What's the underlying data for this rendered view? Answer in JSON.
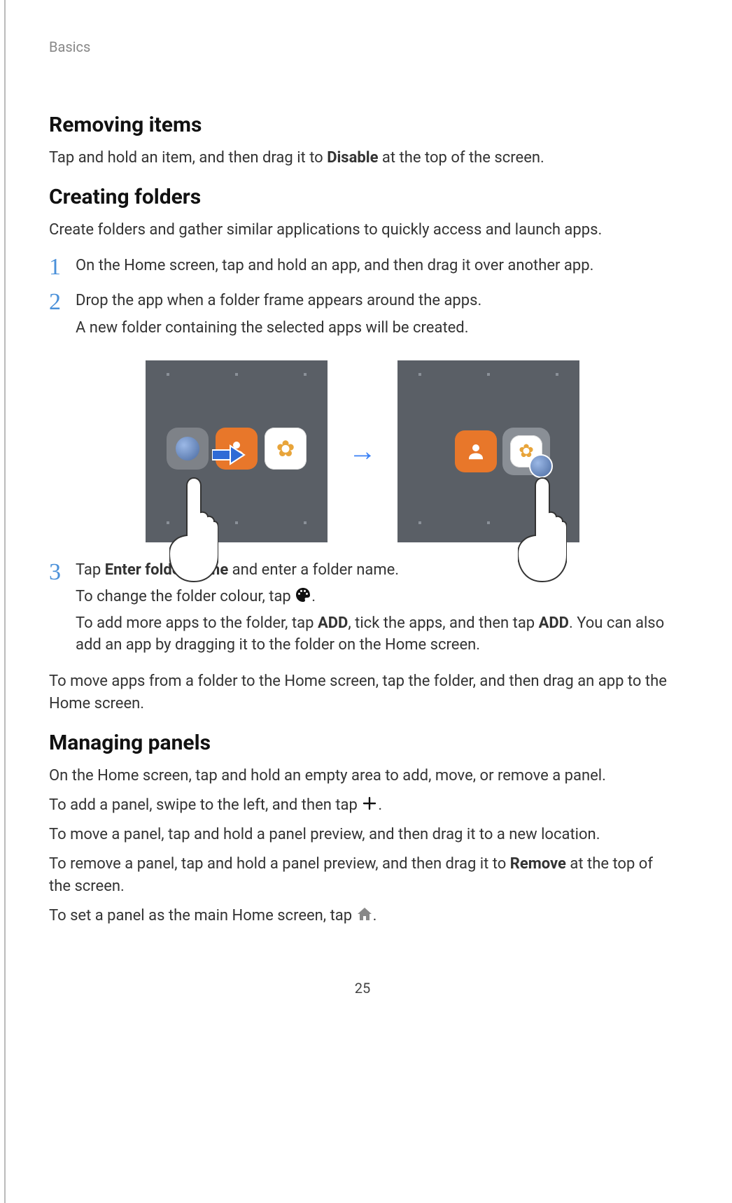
{
  "header": {
    "section": "Basics"
  },
  "removing": {
    "heading": "Removing items",
    "text_pre": "Tap and hold an item, and then drag it to ",
    "text_bold": "Disable",
    "text_post": " at the top of the screen."
  },
  "creating": {
    "heading": "Creating folders",
    "intro": "Create folders and gather similar applications to quickly access and launch apps.",
    "step1_num": "1",
    "step1_text": "On the Home screen, tap and hold an app, and then drag it over another app.",
    "step2_num": "2",
    "step2_line1": "Drop the app when a folder frame appears around the apps.",
    "step2_line2": "A new folder containing the selected apps will be created.",
    "step3_num": "3",
    "step3_l1_pre": "Tap ",
    "step3_l1_bold": "Enter folder name",
    "step3_l1_post": " and enter a folder name.",
    "step3_l2_pre": "To change the folder colour, tap ",
    "step3_l2_post": ".",
    "step3_l3_pre": "To add more apps to the folder, tap ",
    "step3_l3_b1": "ADD",
    "step3_l3_mid": ", tick the apps, and then tap ",
    "step3_l3_b2": "ADD",
    "step3_l3_post": ". You can also add an app by dragging it to the folder on the Home screen.",
    "after_steps": "To move apps from a folder to the Home screen, tap the folder, and then drag an app to the Home screen."
  },
  "managing": {
    "heading": "Managing panels",
    "p1": "On the Home screen, tap and hold an empty area to add, move, or remove a panel.",
    "p2_pre": "To add a panel, swipe to the left, and then tap ",
    "p2_post": ".",
    "p3": "To move a panel, tap and hold a panel preview, and then drag it to a new location.",
    "p4_pre": "To remove a panel, tap and hold a panel preview, and then drag it to ",
    "p4_bold": "Remove",
    "p4_post": " at the top of the screen.",
    "p5_pre": "To set a panel as the main Home screen, tap ",
    "p5_post": "."
  },
  "page_number": "25"
}
